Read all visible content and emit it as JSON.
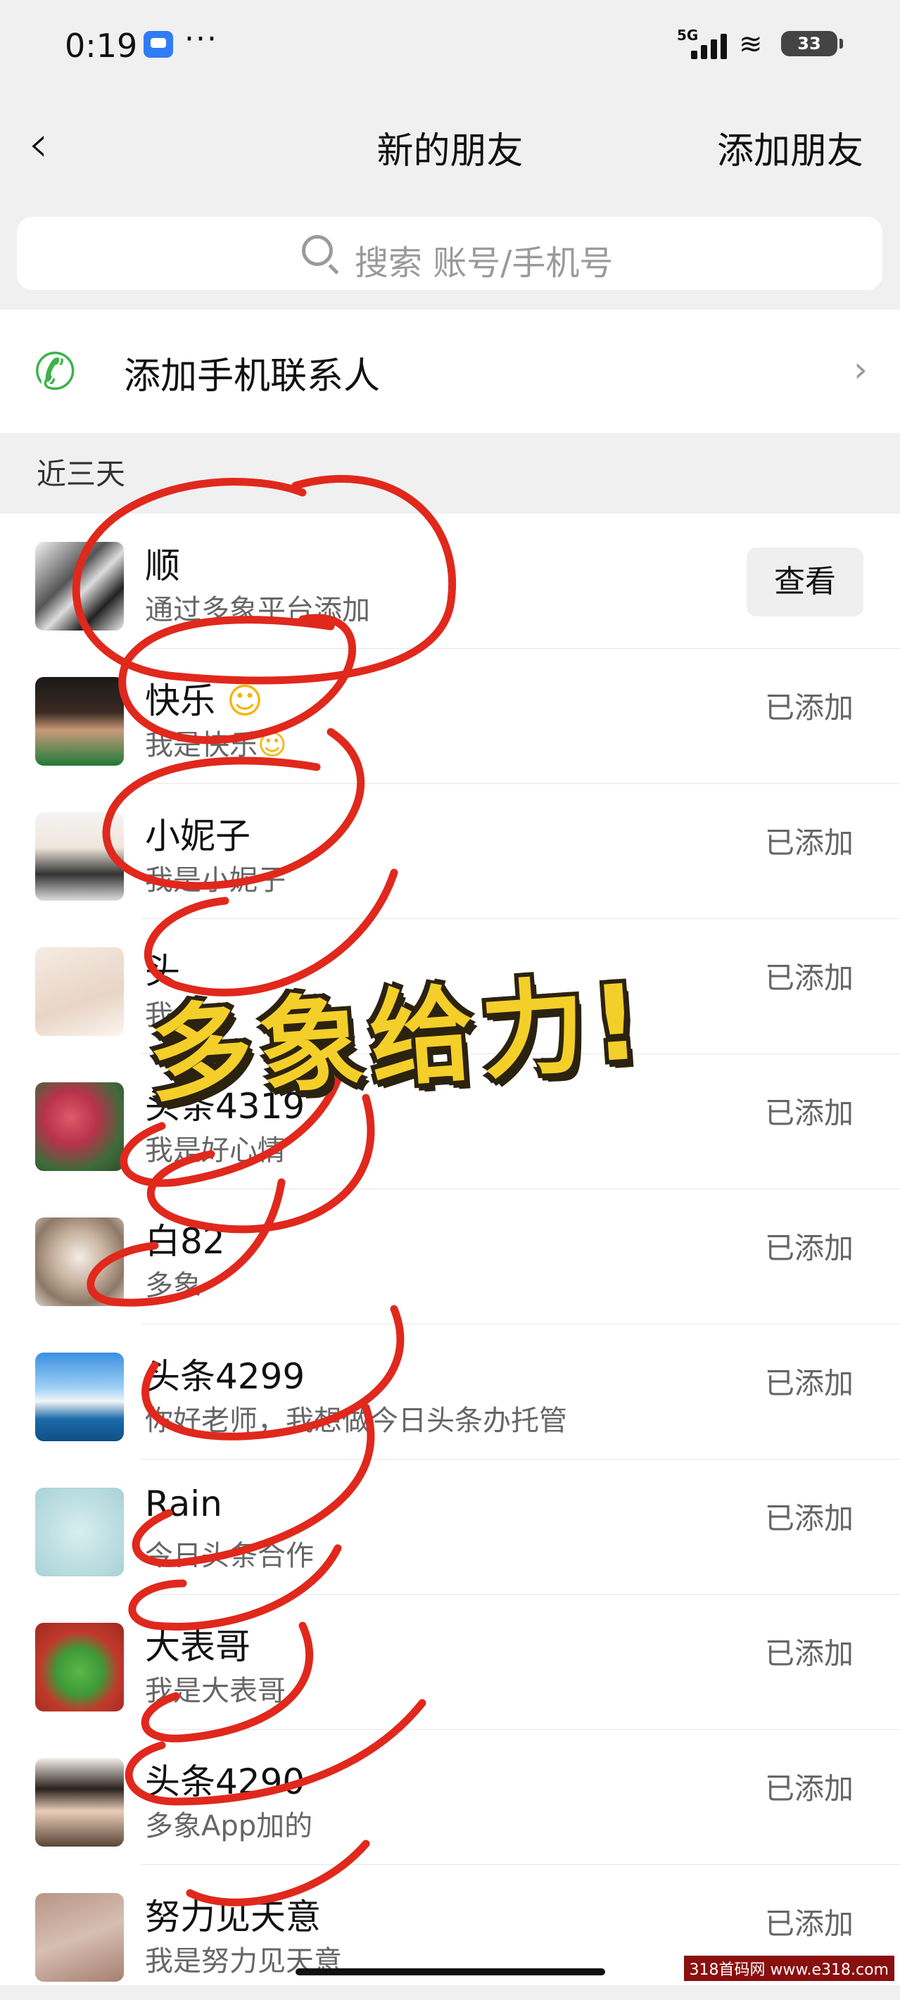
{
  "status_bar": {
    "time": "0:19",
    "network": "5G",
    "battery": "33"
  },
  "navbar": {
    "back_glyph": "‹",
    "title": "新的朋友",
    "add_friend": "添加朋友"
  },
  "search": {
    "placeholder": "搜索 账号/手机号"
  },
  "add_contacts": {
    "label": "添加手机联系人"
  },
  "section": {
    "recent": "近三天"
  },
  "requests": [
    {
      "name": "顺",
      "message": "通过多象平台添加",
      "action": "查看"
    },
    {
      "name": "快乐",
      "message": "我是快乐",
      "action": "已添加"
    },
    {
      "name": "小妮子",
      "message": "我是小妮子",
      "action": "已添加"
    },
    {
      "name": "头",
      "message": "我",
      "action": "已添加"
    },
    {
      "name": "头条4319",
      "message": "我是好心情",
      "action": "已添加"
    },
    {
      "name": "白82",
      "message": "多象",
      "action": "已添加"
    },
    {
      "name": "头条4299",
      "message": "你好老师，我想做今日头条办托管",
      "action": "已添加"
    },
    {
      "name": "Rain",
      "message": "今日头条合作",
      "action": "已添加"
    },
    {
      "name": "大表哥",
      "message": "我是大表哥",
      "action": "已添加"
    },
    {
      "name": "头条4290",
      "message": "多象App加的",
      "action": "已添加"
    },
    {
      "name": "努力见天意",
      "message": "我是努力见天意",
      "action": "已添加"
    }
  ],
  "overlay": {
    "headline": "多象给力!"
  },
  "watermark": "318首码网 www.e318.com",
  "colors": {
    "scribble": "#e0281c",
    "headline_fill": "#f4cf2a",
    "phone_icon": "#3cb34a"
  }
}
